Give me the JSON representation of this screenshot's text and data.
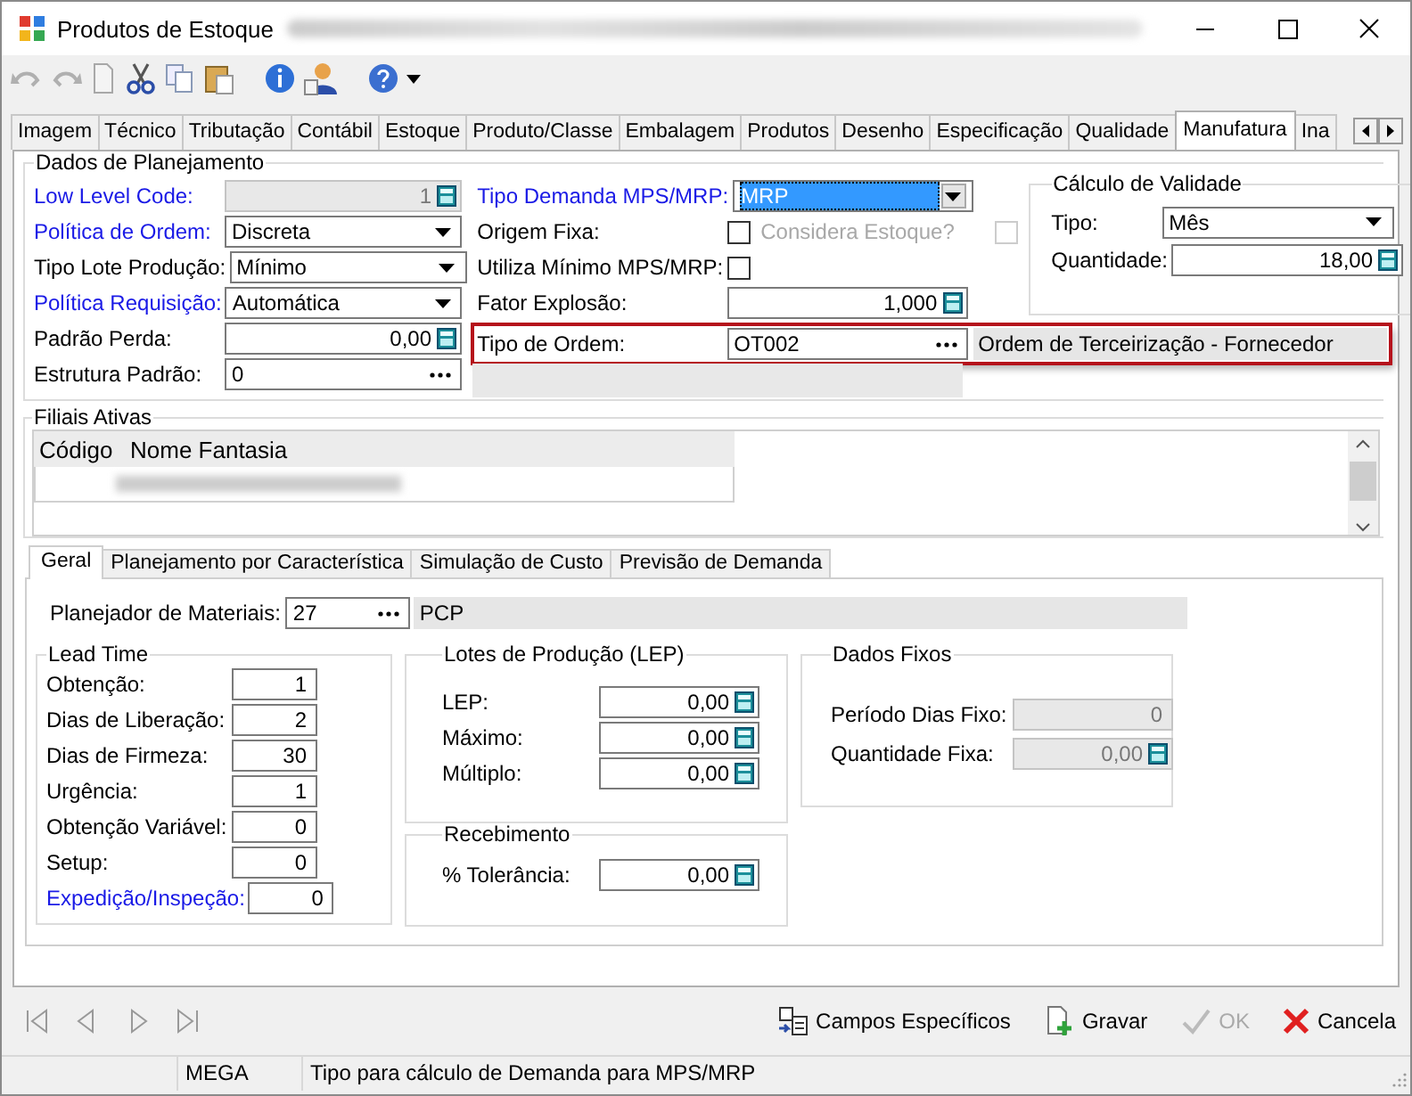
{
  "window": {
    "title": "Produtos de Estoque"
  },
  "tabs": [
    {
      "label": "Imagem",
      "selected": false
    },
    {
      "label": "Técnico",
      "selected": false
    },
    {
      "label": "Tributação",
      "selected": false
    },
    {
      "label": "Contábil",
      "selected": false
    },
    {
      "label": "Estoque",
      "selected": false
    },
    {
      "label": "Produto/Classe",
      "selected": false
    },
    {
      "label": "Embalagem",
      "selected": false
    },
    {
      "label": "Produtos",
      "selected": false
    },
    {
      "label": "Desenho",
      "selected": false
    },
    {
      "label": "Especificação",
      "selected": false
    },
    {
      "label": "Qualidade",
      "selected": false
    },
    {
      "label": "Manufatura",
      "selected": true
    },
    {
      "label": "Ina",
      "selected": false
    }
  ],
  "planning": {
    "title": "Dados de Planejamento",
    "left": [
      {
        "label": "Low Level Code:",
        "linked": true,
        "kind": "number",
        "value": "1",
        "disabled": true
      },
      {
        "label": "Política de Ordem:",
        "linked": true,
        "kind": "select",
        "value": "Discreta",
        "disabled": false
      },
      {
        "label": "Tipo Lote Produção:",
        "linked": false,
        "kind": "select",
        "value": "Mínimo",
        "disabled": false
      },
      {
        "label": "Política Requisição:",
        "linked": true,
        "kind": "select",
        "value": "Automática",
        "disabled": false
      },
      {
        "label": "Padrão Perda:",
        "linked": false,
        "kind": "number",
        "value": "0,00",
        "disabled": false
      },
      {
        "label": "Estrutura Padrão:",
        "linked": false,
        "kind": "lookup",
        "value": "0",
        "disabled": false
      }
    ],
    "middle": [
      {
        "label": "Tipo Demanda MPS/MRP:",
        "linked": true,
        "kind": "select",
        "value": "MRP",
        "focused": true
      },
      {
        "label": "Origem Fixa:",
        "linked": false,
        "kind": "checkbox",
        "checked": false,
        "extra": {
          "label": "Considera Estoque?",
          "checked": false,
          "disabled": true
        }
      },
      {
        "label": "Utiliza Mínimo MPS/MRP:",
        "linked": false,
        "kind": "checkbox",
        "checked": false
      },
      {
        "label": "Fator Explosão:",
        "linked": false,
        "kind": "number",
        "value": "1,000"
      }
    ],
    "order_type": {
      "label": "Tipo de Ordem:",
      "kind": "lookup",
      "value": "OT002",
      "description": "Ordem de Terceirização - Fornecedor",
      "highlighted": true
    },
    "validity": {
      "title": "Cálculo de Validade",
      "fields": [
        {
          "label": "Tipo:",
          "kind": "select",
          "value": "Mês"
        },
        {
          "label": "Quantidade:",
          "kind": "number",
          "value": "18,00"
        }
      ]
    }
  },
  "branches": {
    "title": "Filiais Ativas",
    "columns": [
      "Código",
      "Nome Fantasia"
    ]
  },
  "subtabs": [
    {
      "label": "Geral",
      "selected": true
    },
    {
      "label": "Planejamento por Característica",
      "selected": false
    },
    {
      "label": "Simulação de Custo",
      "selected": false
    },
    {
      "label": "Previsão de Demanda",
      "selected": false
    }
  ],
  "planner": {
    "label": "Planejador de Materiais:",
    "kind": "lookup",
    "value": "27",
    "description": "PCP"
  },
  "lead_time": {
    "title": "Lead Time",
    "fields": [
      {
        "label": "Obtenção:",
        "linked": false,
        "kind": "integer",
        "value": "1"
      },
      {
        "label": "Dias de Liberação:",
        "linked": false,
        "kind": "integer",
        "value": "2"
      },
      {
        "label": "Dias de Firmeza:",
        "linked": false,
        "kind": "integer",
        "value": "30"
      },
      {
        "label": "Urgência:",
        "linked": false,
        "kind": "integer",
        "value": "1"
      },
      {
        "label": "Obtenção Variável:",
        "linked": false,
        "kind": "integer",
        "value": "0"
      },
      {
        "label": "Setup:",
        "linked": false,
        "kind": "integer",
        "value": "0"
      },
      {
        "label": "Expedição/Inspeção:",
        "linked": true,
        "kind": "integer",
        "value": "0"
      }
    ]
  },
  "lots": {
    "title": "Lotes de Produção (LEP)",
    "fields": [
      {
        "label": "LEP:",
        "kind": "number",
        "value": "0,00"
      },
      {
        "label": "Máximo:",
        "kind": "number",
        "value": "0,00"
      },
      {
        "label": "Múltiplo:",
        "kind": "number",
        "value": "0,00"
      }
    ]
  },
  "receiving": {
    "title": "Recebimento",
    "fields": [
      {
        "label": "% Tolerância:",
        "kind": "number",
        "value": "0,00"
      }
    ]
  },
  "fixed": {
    "title": "Dados Fixos",
    "fields": [
      {
        "label": "Período Dias Fixo:",
        "kind": "integer",
        "value": "0",
        "disabled": true
      },
      {
        "label": "Quantidade Fixa:",
        "kind": "number",
        "value": "0,00",
        "disabled": true
      }
    ]
  },
  "actions": [
    {
      "label": "Campos Específicos",
      "kind": "fields",
      "disabled": false
    },
    {
      "label": "Gravar",
      "kind": "save",
      "disabled": false
    },
    {
      "label": "OK",
      "kind": "ok",
      "disabled": true
    },
    {
      "label": "Cancela",
      "kind": "cancel",
      "disabled": false
    }
  ],
  "status_bar": [
    "MEGA",
    "Tipo para cálculo de Demanda para MPS/MRP"
  ]
}
